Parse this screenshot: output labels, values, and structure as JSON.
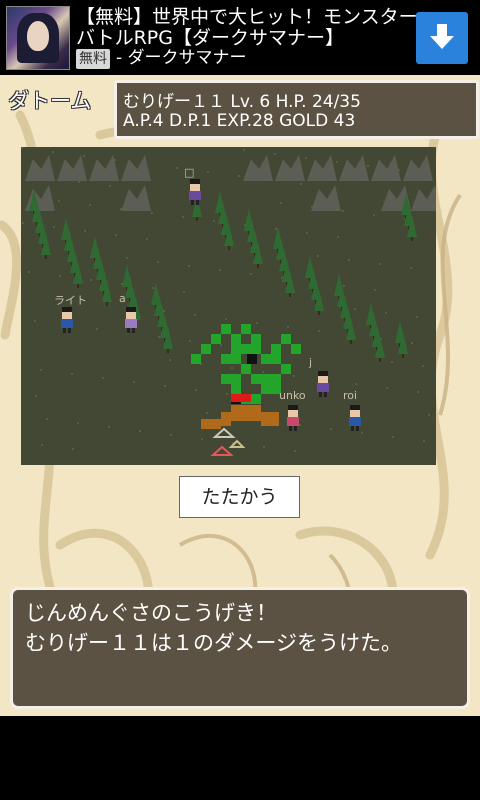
{
  "ad": {
    "line1": "【無料】世界中で大ヒット！モンスター",
    "line2": "バトルRPG【ダークサマナー】",
    "badge": "無料",
    "source": "- ダークサマナー",
    "thumbnail_icon": "dark-summoner-thumbnail",
    "download_icon": "download-arrow-icon",
    "accent": "#2a82dc"
  },
  "battle": {
    "enemy_name": "ダトーム",
    "status_line1": "むりげー１１  Lv.  6  H.P. 24/35",
    "status_line2": "A.P.4 D.P.1 EXP.28 GOLD 43",
    "players": [
      {
        "name": "□"
      },
      {
        "name": "ライト"
      },
      {
        "name": "a"
      },
      {
        "name": "j"
      },
      {
        "name": "unko"
      },
      {
        "name": "roi"
      }
    ],
    "action_button": "たたかう",
    "message_line1": "じんめんぐさのこうげき！",
    "message_line2": "むりげー１１は１のダメージをうけた。"
  }
}
